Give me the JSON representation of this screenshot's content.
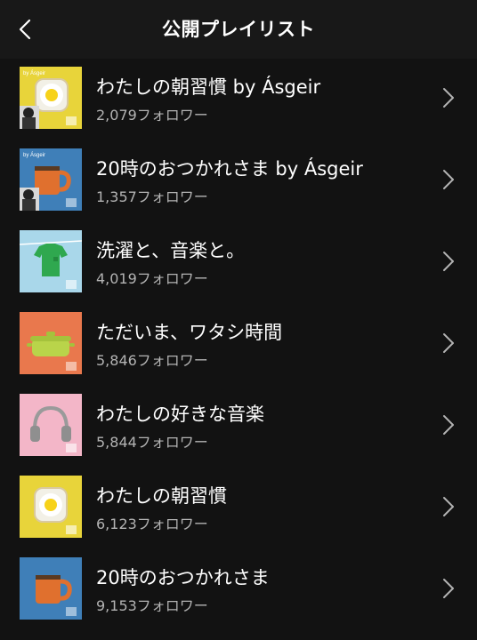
{
  "header": {
    "title": "公開プレイリスト",
    "back_icon": "chevron-left-icon"
  },
  "colors": {
    "background": "#121212",
    "header": "#181818",
    "title_text": "#ffffff",
    "subtitle_text": "#b3b3b3",
    "chevron": "#b3b3b3"
  },
  "playlists": [
    {
      "title": "わたしの朝習慣 by Ásgeir",
      "followers": "2,079フォロワー",
      "cover": "toast-egg",
      "cover_label": "by Ásgeir",
      "artist_photo": true
    },
    {
      "title": "20時のおつかれさま by Ásgeir",
      "followers": "1,357フォロワー",
      "cover": "mug",
      "cover_label": "by Ásgeir",
      "artist_photo": true
    },
    {
      "title": "洗濯と、音楽と。",
      "followers": "4,019フォロワー",
      "cover": "tshirt",
      "cover_label": "",
      "artist_photo": false
    },
    {
      "title": "ただいま、ワタシ時間",
      "followers": "5,846フォロワー",
      "cover": "pot",
      "cover_label": "",
      "artist_photo": false
    },
    {
      "title": "わたしの好きな音楽",
      "followers": "5,844フォロワー",
      "cover": "headphones",
      "cover_label": "",
      "artist_photo": false
    },
    {
      "title": "わたしの朝習慣",
      "followers": "6,123フォロワー",
      "cover": "toast-egg",
      "cover_label": "",
      "artist_photo": false
    },
    {
      "title": "20時のおつかれさま",
      "followers": "9,153フォロワー",
      "cover": "mug",
      "cover_label": "",
      "artist_photo": false
    }
  ]
}
